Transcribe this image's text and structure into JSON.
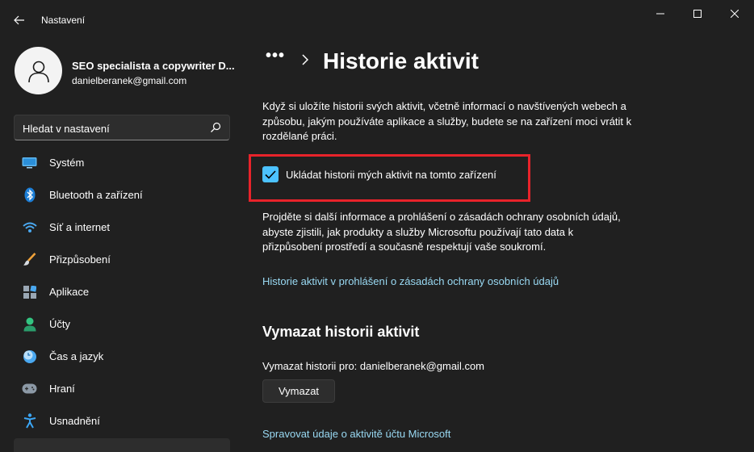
{
  "window": {
    "app_title": "Nastavení",
    "back_icon": "back-arrow-icon",
    "minimize_icon": "minimize-icon",
    "maximize_icon": "maximize-icon",
    "close_icon": "close-icon"
  },
  "profile": {
    "name": "SEO specialista a copywriter D...",
    "email": "danielberanek@gmail.com",
    "avatar_icon": "user-avatar-icon"
  },
  "search": {
    "placeholder": "Hledat v nastavení",
    "icon": "search-icon"
  },
  "nav": {
    "items": [
      {
        "label": "Systém",
        "icon": "system-monitor-icon"
      },
      {
        "label": "Bluetooth a zařízení",
        "icon": "bluetooth-icon"
      },
      {
        "label": "Síť a internet",
        "icon": "wifi-icon"
      },
      {
        "label": "Přizpůsobení",
        "icon": "brush-icon"
      },
      {
        "label": "Aplikace",
        "icon": "apps-icon"
      },
      {
        "label": "Účty",
        "icon": "account-icon"
      },
      {
        "label": "Čas a jazyk",
        "icon": "clock-globe-icon"
      },
      {
        "label": "Hraní",
        "icon": "gamepad-icon"
      },
      {
        "label": "Usnadnění",
        "icon": "accessibility-icon"
      }
    ]
  },
  "main": {
    "breadcrumb_more": "•••",
    "title": "Historie aktivit",
    "intro": "Když si uložíte historii svých aktivit, včetně informací o navštívených webech a způsobu, jakým používáte aplikace a služby, budete se na zařízení moci vrátit k rozdělané práci.",
    "checkbox_label": "Ukládat historii mých aktivit na tomto zařízení",
    "checkbox_checked": true,
    "privacy_text": "Projděte si další informace a prohlášení o zásadách ochrany osobních údajů, abyste zjistili, jak produkty a služby Microsoftu používají tato data k přizpůsobení prostředí a současně respektují vaše soukromí.",
    "privacy_link": "Historie aktivit v prohlášení o zásadách ochrany osobních údajů",
    "clear_section_title": "Vymazat historii aktivit",
    "clear_for": "Vymazat historii pro: danielberanek@gmail.com",
    "clear_button": "Vymazat",
    "manage_link": "Spravovat údaje o aktivitě účtu Microsoft"
  },
  "colors": {
    "accent": "#4cc2ff",
    "link": "#99d9f3",
    "highlight": "#e8232a",
    "background": "#202020"
  }
}
